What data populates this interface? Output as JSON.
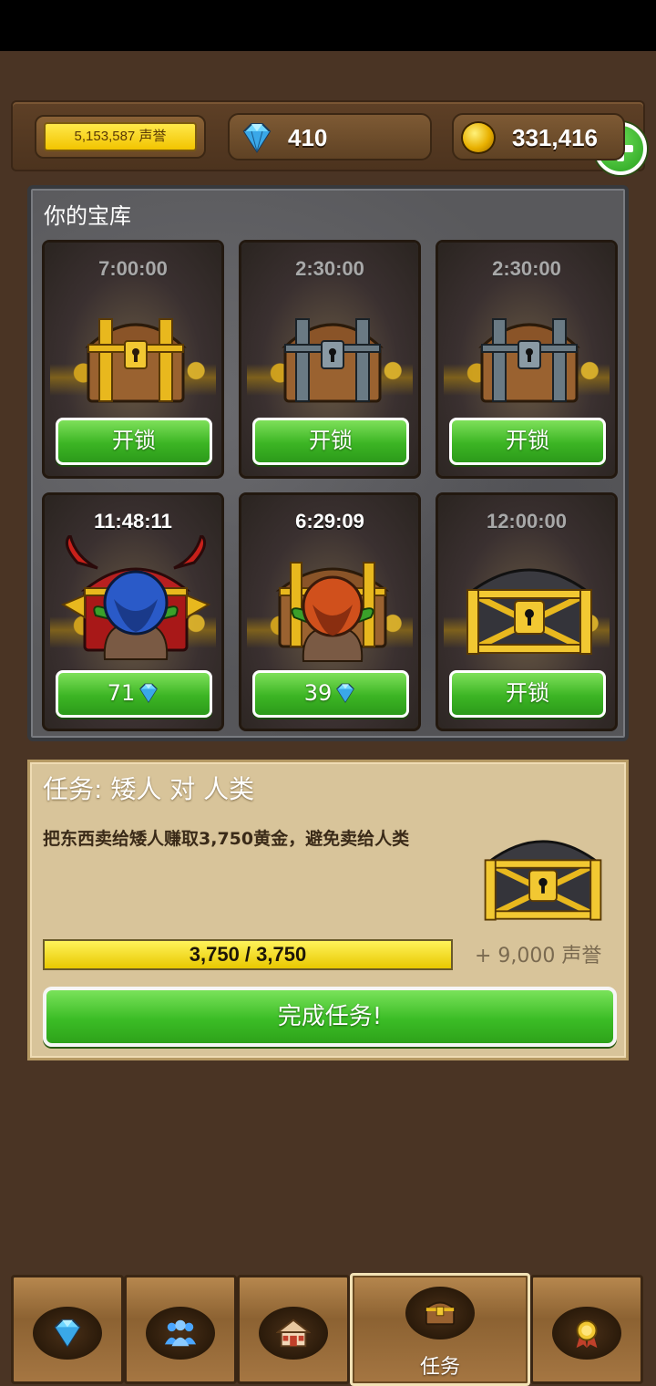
{
  "header": {
    "fame": "5,153,587 声誉",
    "gems": "410",
    "gold": "331,416"
  },
  "vault": {
    "title": "你的宝库",
    "slots": [
      {
        "timer": "7:00:00",
        "button": "开锁",
        "chest": "wooden-gold-chest"
      },
      {
        "timer": "2:30:00",
        "button": "开锁",
        "chest": "wooden-iron-chest"
      },
      {
        "timer": "2:30:00",
        "button": "开锁",
        "chest": "wooden-iron-chest"
      },
      {
        "timer": "11:48:11",
        "button": "71",
        "chest": "demon-chest-with-goblin"
      },
      {
        "timer": "6:29:09",
        "button": "39",
        "chest": "wooden-chest-with-goblin"
      },
      {
        "timer": "12:00:00",
        "button": "开锁",
        "chest": "dark-gold-chest"
      }
    ]
  },
  "quest": {
    "title": "任务: 矮人 对 人类",
    "description": "把东西卖给矮人赚取3,750黄金，避免卖给人类",
    "progress_text": "3,750 / 3,750",
    "progress": 1.0,
    "reward": "+ 9,000 声誉",
    "complete_button": "完成任务!"
  },
  "nav": {
    "tabs": [
      {
        "icon": "gem-icon",
        "label": ""
      },
      {
        "icon": "people-icon",
        "label": ""
      },
      {
        "icon": "house-icon",
        "label": ""
      },
      {
        "icon": "chest-icon",
        "label": "任务"
      },
      {
        "icon": "medal-icon",
        "label": ""
      }
    ]
  },
  "colors": {
    "background": "#4a3424",
    "button_green": "#3cb524",
    "progress_yellow": "#f2d400",
    "quest_panel": "#d8c49a"
  }
}
